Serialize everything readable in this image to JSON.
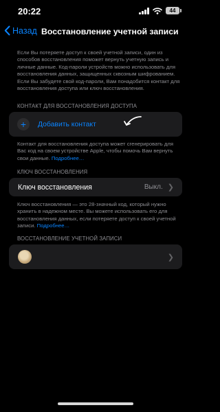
{
  "status_bar": {
    "time": "20:22",
    "battery": "44"
  },
  "nav": {
    "back_label": "Назад",
    "title": "Восстановление учетной записи"
  },
  "intro": "Если Вы потеряете доступ к своей учетной записи, один из способов восстановления поможет вернуть учетную запись и личные данные. Код-пароли устройств можно использовать для восстановления данных, защищенных сквозным шифрованием. Если Вы забудете свой код-пароли, Вам понадобится контакт для восстановления доступа или ключ восстановления.",
  "recovery_contact": {
    "header": "КОНТАКТ ДЛЯ ВОССТАНОВЛЕНИЯ ДОСТУПА",
    "add_label": "Добавить контакт",
    "footer": "Контакт для восстановления доступа может сгенерировать для Вас код на своем устройстве Apple, чтобы помочь Вам вернуть свои данные.",
    "more_link": "Подробнее…"
  },
  "recovery_key": {
    "header": "КЛЮЧ ВОССТАНОВЛЕНИЯ",
    "row_label": "Ключ восстановления",
    "row_value": "Выкл.",
    "footer": "Ключ восстановления — это 28-значный код, который нужно хранить в надежном месте. Вы можете использовать его для восстановления данных, если потеряете доступ к своей учетной записи.",
    "more_link": "Подробнее…"
  },
  "account_recovery": {
    "header": "ВОССТАНОВЛЕНИЕ УЧЕТНОЙ ЗАПИСИ"
  },
  "icons": {
    "back": "chevron-left-icon",
    "plus": "plus-circle-icon",
    "chevron": "chevron-right-icon"
  },
  "colors": {
    "accent": "#0a84ff",
    "background": "#000000",
    "group_bg": "#1c1c1e",
    "secondary_text": "#8e8e93"
  }
}
